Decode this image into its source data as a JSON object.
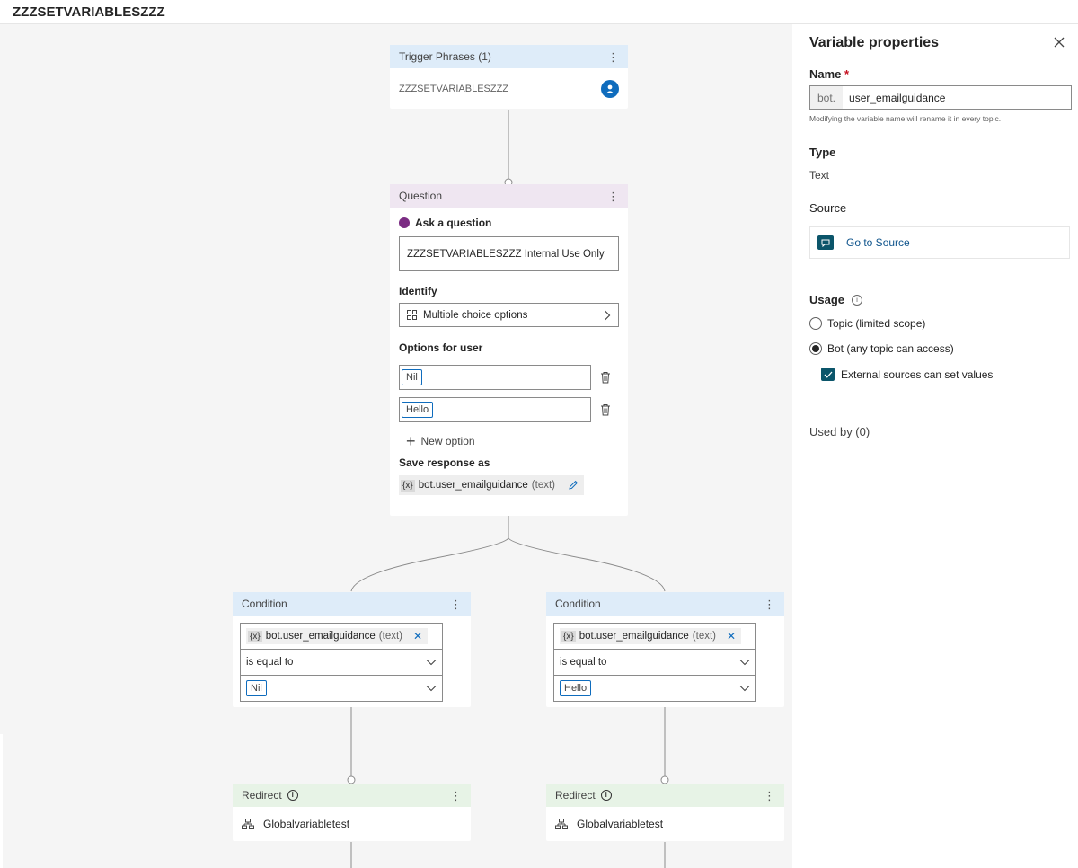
{
  "topic_title": "ZZZSETVARIABLESZZZ",
  "trigger": {
    "header": "Trigger Phrases (1)",
    "phrase": "ZZZSETVARIABLESZZZ"
  },
  "question": {
    "header": "Question",
    "ask_label": "Ask a question",
    "message": "ZZZSETVARIABLESZZZ Internal Use Only",
    "identify_label": "Identify",
    "identify_value": "Multiple choice options",
    "options_label": "Options for user",
    "options": [
      "Nil",
      "Hello"
    ],
    "new_option": "New option",
    "save_label": "Save response as",
    "save_var_badge": "{x}",
    "save_var": "bot.user_emailguidance",
    "save_type": "(text)"
  },
  "conditions": [
    {
      "header": "Condition",
      "var_badge": "{x}",
      "var": "bot.user_emailguidance",
      "var_type": "(text)",
      "operator": "is equal to",
      "value": "Nil"
    },
    {
      "header": "Condition",
      "var_badge": "{x}",
      "var": "bot.user_emailguidance",
      "var_type": "(text)",
      "operator": "is equal to",
      "value": "Hello"
    }
  ],
  "redirects": [
    {
      "header": "Redirect",
      "target": "Globalvariabletest"
    },
    {
      "header": "Redirect",
      "target": "Globalvariabletest"
    }
  ],
  "panel": {
    "title": "Variable properties",
    "name_label": "Name",
    "required_mark": "*",
    "name_prefix": "bot.",
    "name_value": "user_emailguidance",
    "name_hint": "Modifying the variable name will rename it in every topic.",
    "type_label": "Type",
    "type_value": "Text",
    "source_label": "Source",
    "source_link": "Go to Source",
    "usage_label": "Usage",
    "usage_options": [
      {
        "label": "Topic (limited scope)",
        "selected": false
      },
      {
        "label": "Bot (any topic can access)",
        "selected": true
      }
    ],
    "external_label": "External sources can set values",
    "external_checked": true,
    "used_by": "Used by (0)"
  },
  "colors": {
    "accent": "#0f6cbd",
    "teal": "#0b556a",
    "header_blue": "#deecf9",
    "header_purple": "#efe6f1",
    "header_green": "#e7f3e6"
  }
}
